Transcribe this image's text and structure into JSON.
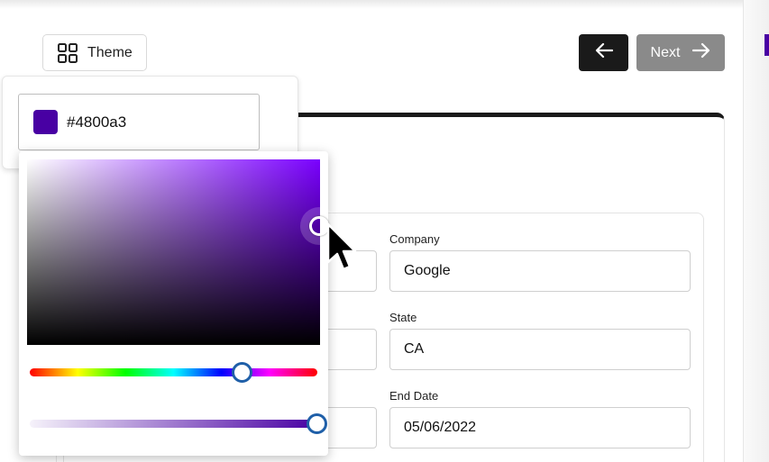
{
  "toolbar": {
    "theme_label": "Theme",
    "theme_icon": "grid-icon",
    "back_icon": "arrow-left-icon",
    "next_label": "Next",
    "next_icon": "arrow-right-icon"
  },
  "color_picker": {
    "hex_value": "#4800a3",
    "swatch_color": "#4800a3",
    "hue_color": "#7a00ff",
    "alpha_level": 1.0
  },
  "form": {
    "fields": [
      {
        "label": "Company",
        "value": "Google"
      },
      {
        "label": "State",
        "value": "CA"
      },
      {
        "label": "End Date",
        "value": "05/06/2022"
      }
    ]
  },
  "colors": {
    "accent": "#4800a3",
    "primary_button": "#1a1a1a",
    "disabled_button": "#8a8a8a",
    "slider_handle_border": "#1f5fa8"
  }
}
